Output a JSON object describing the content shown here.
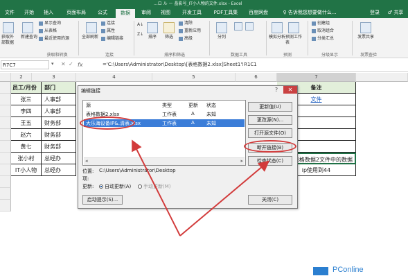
{
  "window": {
    "title": "...ロ ル ー 晶影号_IT小人物的文件.xlsx - Excel"
  },
  "tabs": [
    "文件",
    "开始",
    "插入",
    "页面布局",
    "公式",
    "数据",
    "审阅",
    "视图",
    "开发工具",
    "PDF工具集",
    "百度网盘",
    "♀ 告诉我您想要做什么...",
    "登录",
    "♂ 共享"
  ],
  "ribbon": {
    "get_external": "获取外部数据",
    "new_query": "新建查询",
    "show_query": "显示查询",
    "from_table": "从表格",
    "recent_sources": "最近使用的源",
    "get_transform": "获取和转换",
    "refresh_all": "全部刷新",
    "connections": "连接",
    "properties": "属性",
    "edit_links": "编辑链接",
    "conn_group": "连接",
    "sort": "排序",
    "filter": "筛选",
    "clear": "清除",
    "reapply": "重新应用",
    "advanced": "高级",
    "sort_filter_group": "排序和筛选",
    "text_to_columns": "分列",
    "data_tools_group": "数据工具",
    "what_if": "模拟分析",
    "forecast_sheet": "预测工作表",
    "forecast_group": "预测",
    "group": "创建组",
    "ungroup": "取消组合",
    "subtotal": "分类汇总",
    "outline_group": "分级显示",
    "share_sheet": "发票共享",
    "share_group": "发票查验"
  },
  "formula_bar": {
    "namebox": "R7C7",
    "fx": "fx",
    "formula": "='C:\\Users\\Administrator\\Desktop\\[表格数据2.xlsx]Sheet1'!R1C1"
  },
  "columns": [
    "2",
    "3",
    "4",
    "5",
    "6",
    "7"
  ],
  "table": {
    "header": [
      "员工/月份",
      "部门"
    ],
    "note_header": "备注",
    "note_link": "文件",
    "rows": [
      [
        "张三",
        "人事部"
      ],
      [
        "李四",
        "人事部"
      ],
      [
        "王五",
        "财务部"
      ],
      [
        "赵六",
        "财务部"
      ],
      [
        "黄七",
        "财务部"
      ],
      [
        "张小村",
        "总经办"
      ],
      [
        "IT小人物",
        "总经办"
      ]
    ],
    "note_rows": [
      "",
      "",
      "",
      "",
      "",
      "表格数据2文件中的数据",
      "ip使用到44"
    ]
  },
  "dialog": {
    "title": "编辑链接",
    "close": "✕",
    "help": "?",
    "list_headers": [
      "源",
      "类型",
      "更新",
      "状态"
    ],
    "links": [
      {
        "source": "表格数据2.xlsx",
        "type": "工作表",
        "update": "A",
        "status": "未知"
      },
      {
        "source": "大乐海设备IP&.清表.xlsx",
        "type": "工作表",
        "update": "A",
        "status": "未知"
      }
    ],
    "buttons": [
      "更新值(U)",
      "更改源(N)...",
      "打开源文件(O)",
      "断开链接(B)",
      "检查状态(C)"
    ],
    "location_label": "位置:",
    "location_value": "C:\\Users\\Administrator\\Desktop",
    "item_label": "项:",
    "update_label": "更新:",
    "auto_update": "自动更新(A)",
    "manual_update": "手动更新(M)",
    "startup_button": "启动提示(S)...",
    "close_button": "关闭(C)"
  },
  "watermark": "PConline",
  "colors": {
    "excel_green": "#217346",
    "annotation_red": "#d23b3b",
    "selection_blue": "#3b7dd8"
  }
}
